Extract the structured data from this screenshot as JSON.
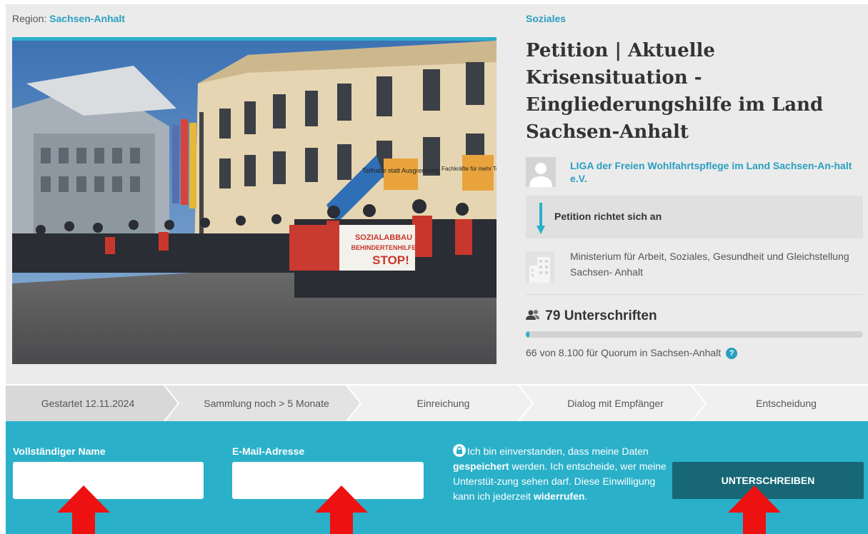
{
  "region": {
    "label": "Region:",
    "value": "Sachsen-Anhalt"
  },
  "category": "Soziales",
  "title": "Petition | Aktuelle Krisensituation - Eingliederungshilfe im Land Sachsen-Anhalt",
  "photo": {
    "banner_line1": "SOZIALABBAU",
    "banner_line2": "BEHINDERTENHILFE",
    "banner_line3": "STOP!",
    "sign_left": "Teilhabe statt Ausgrenzung",
    "sign_right": "Fachkräfte für mehr Teilhabe"
  },
  "author": {
    "name": "LIGA der Freien Wohlfahrtspflege im Land Sachsen-An-halt e.V."
  },
  "target": {
    "label": "Petition richtet sich an"
  },
  "recipient": {
    "name": "Ministerium für Arbeit, Soziales, Gesundheit und Gleichstellung Sachsen- Anhalt"
  },
  "signatures": {
    "count_label": "79 Unterschriften",
    "progress_fraction": 0.008,
    "quorum_text": "66 von 8.100 für Quorum in Sachsen-Anhalt"
  },
  "steps": [
    {
      "label": "Gestartet 12.11.2024",
      "state": "done"
    },
    {
      "label": "Sammlung noch > 5 Monate",
      "state": "active"
    },
    {
      "label": "Einreichung",
      "state": "pending"
    },
    {
      "label": "Dialog mit Empfänger",
      "state": "pending"
    },
    {
      "label": "Entscheidung",
      "state": "pending"
    }
  ],
  "form": {
    "name_label": "Vollständiger Name",
    "name_value": "",
    "email_label": "E-Mail-Adresse",
    "email_value": "",
    "consent": {
      "t1": "Ich bin einverstanden, dass meine Daten ",
      "b1": "gespeichert",
      "t2": " werden. Ich entscheide, wer meine Unterstüt-zung sehen darf. Diese Einwilligung kann ich jederzeit ",
      "b2": "widerrufen",
      "t3": "."
    },
    "submit_label": "UNTERSCHREIBEN"
  },
  "colors": {
    "accent": "#2ab0c9",
    "link": "#2a9fc0",
    "submit": "#176776",
    "annotation_arrow": "#ee1111"
  },
  "annotation_icons": [
    "red-arrow-up",
    "red-arrow-up",
    "red-arrow-up"
  ]
}
